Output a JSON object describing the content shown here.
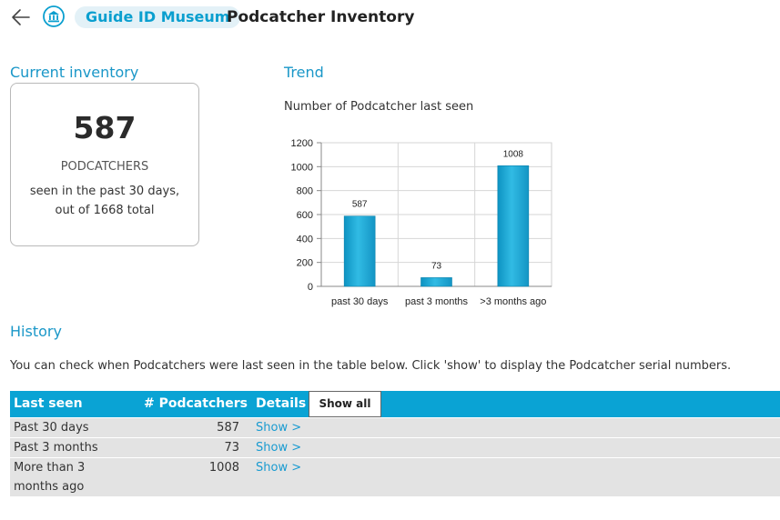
{
  "header": {
    "back_icon": "arrow-left-icon",
    "museum_icon": "museum-icon",
    "breadcrumb": "Guide ID Museum",
    "title": "Podcatcher Inventory"
  },
  "inventory": {
    "section_title": "Current inventory",
    "count": "587",
    "unit": "PODCATCHERS",
    "desc_line1": "seen in the past 30 days,",
    "desc_line2": "out of 1668 total"
  },
  "trend": {
    "section_title": "Trend",
    "subtitle": "Number of Podcatcher last seen"
  },
  "chart_data": {
    "type": "bar",
    "categories": [
      "past 30 days",
      "past 3 months",
      ">3 months ago"
    ],
    "values": [
      587,
      73,
      1008
    ],
    "title": "Number of Podcatcher last seen",
    "xlabel": "",
    "ylabel": "",
    "ylim": [
      0,
      1200
    ],
    "yticks": [
      0,
      200,
      400,
      600,
      800,
      1000,
      1200
    ],
    "grid": true,
    "bar_color": "#1aa6d2"
  },
  "history": {
    "section_title": "History",
    "description": "You can check when Podcatchers were last seen in the table below. Click 'show' to display the Podcatcher serial numbers.",
    "columns": [
      "Last seen",
      "# Podcatchers",
      "Details"
    ],
    "show_all_label": "Show all",
    "rows": [
      {
        "label_line1": "Past 30 days",
        "label_line2": "",
        "count": "587",
        "link": "Show >"
      },
      {
        "label_line1": "Past 3 months",
        "label_line2": "",
        "count": "73",
        "link": "Show >"
      },
      {
        "label_line1": "More than 3",
        "label_line2": "months ago",
        "count": "1008",
        "link": "Show >"
      }
    ],
    "header_color": "#0aa3d4",
    "row_color": "#e3e3e3",
    "link_color": "#1a9bd0"
  }
}
